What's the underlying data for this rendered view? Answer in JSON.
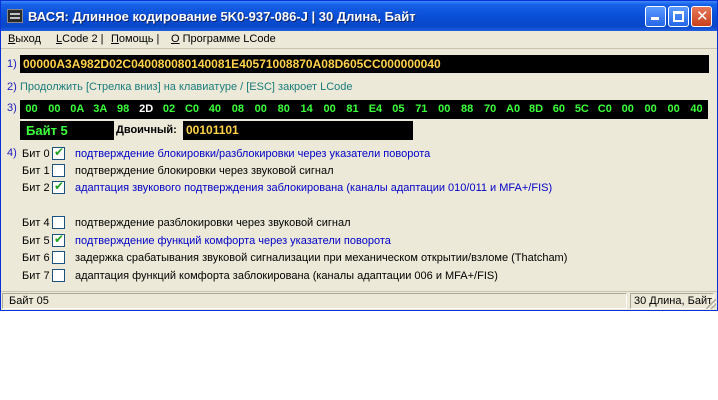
{
  "window": {
    "title": "ВАСЯ: Длинное кодирование  5K0-937-086-J  |  30 Длина, Байт"
  },
  "menu": [
    {
      "label": "Выход",
      "underline": "В",
      "rest": "ыход"
    },
    {
      "label": "LCode 2 |",
      "underline": "L",
      "rest": "Code 2 |"
    },
    {
      "label": "Помощь |",
      "underline": "П",
      "rest": "омощь |"
    },
    {
      "label": "О Программе LCode",
      "underline": "О",
      "rest": " Программе LCode"
    }
  ],
  "section_numbers": [
    "1)",
    "2)",
    "3)",
    "4)"
  ],
  "code_string": "00000A3A982D02C04008008014008 1E40571008870A08D605CC000000040",
  "hint": "Продолжить [Стрелка вниз] на клавиатуре / [ESC] закроет LCode",
  "bytes": [
    "00",
    "00",
    "0A",
    "3A",
    "98",
    "2D",
    "02",
    "C0",
    "40",
    "08",
    "00",
    "80",
    "14",
    "00",
    "81",
    "E4",
    "05",
    "71",
    "00",
    "88",
    "70",
    "A0",
    "8D",
    "60",
    "5C",
    "C0",
    "00",
    "00",
    "00",
    "40"
  ],
  "selected_byte_index": 5,
  "byte_label": "Байт 5",
  "binary_label": "Двоичный:",
  "binary_value": "00101101",
  "bits": [
    {
      "label": "Бит 0",
      "checked": true,
      "text": "подтверждение блокировки/разблокировки через указатели поворота"
    },
    {
      "label": "Бит 1",
      "checked": false,
      "text": "подтверждение блокировки через звуковой сигнал"
    },
    {
      "label": "Бит 2",
      "checked": true,
      "text": "адаптация звукового подтверждения заблокирована (каналы адаптации 010/011 и MFA+/FIS)"
    },
    {
      "label": "Бит 4",
      "checked": false,
      "text": "подтверждение разблокировки через звуковой сигнал"
    },
    {
      "label": "Бит 5",
      "checked": true,
      "text": "подтверждение функций комфорта через указатели поворота"
    },
    {
      "label": "Бит 6",
      "checked": false,
      "text": "задержка срабатывания звуковой сигнализации при механическом открытии/взломе (Thatcham)"
    },
    {
      "label": "Бит 7",
      "checked": false,
      "text": "адаптация функций комфорта заблокирована (каналы адаптации 006 и MFA+/FIS)"
    }
  ],
  "status": {
    "left": "Байт 05",
    "right": "30 Длина, Байт"
  },
  "colors": {
    "titlebar": "#0a4fd8",
    "window_bg": "#ece9d8",
    "hex_text": "#ffd24a",
    "byte_text": "#3cff3c",
    "checked_text": "#0000c8",
    "hint_text": "#1a7c7c"
  }
}
